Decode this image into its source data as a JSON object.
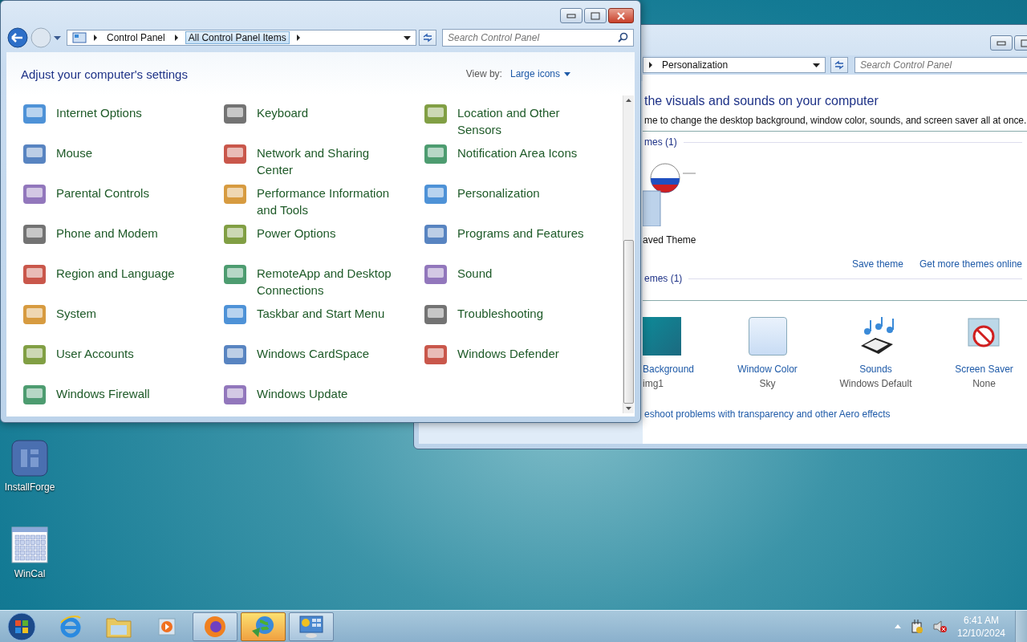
{
  "desktop_icons": [
    {
      "kind": "installer",
      "label": "InstallForge"
    },
    {
      "kind": "calendar",
      "label": "WinCal"
    }
  ],
  "background_window": {
    "breadcrumb": "Personalization",
    "search": {
      "placeholder": "Search Control Panel"
    },
    "heading": "the visuals and sounds on your computer",
    "description": "me to change the desktop background, window color, sounds, and screen saver all at once.",
    "my_themes_header": "mes (1)",
    "theme_name": "aved Theme",
    "links": [
      "Save theme",
      "Get more themes online"
    ],
    "installed_themes_header": "emes (1)",
    "settings": [
      {
        "kind": "background",
        "title": "Background",
        "value": "img1"
      },
      {
        "kind": "color",
        "title": "Window Color",
        "value": "Sky"
      },
      {
        "kind": "sounds",
        "title": "Sounds",
        "value": "Windows Default"
      },
      {
        "kind": "screensaver",
        "title": "Screen Saver",
        "value": "None"
      }
    ],
    "footer_link": "eshoot problems with transparency and other Aero effects"
  },
  "front_window": {
    "crumbs": [
      {
        "label": "Control Panel",
        "hovered": false
      },
      {
        "label": "All Control Panel Items",
        "hovered": true
      }
    ],
    "search": {
      "placeholder": "Search Control Panel"
    },
    "heading": "Adjust your computer's settings",
    "view_by": {
      "label": "View by:",
      "value": "Large icons"
    },
    "items": [
      "Internet Options",
      "Keyboard",
      "Location and Other Sensors",
      "Mouse",
      "Network and Sharing Center",
      "Notification Area Icons",
      "Parental Controls",
      "Performance Information and Tools",
      "Personalization",
      "Phone and Modem",
      "Power Options",
      "Programs and Features",
      "Region and Language",
      "RemoteApp and Desktop Connections",
      "Sound",
      "System",
      "Taskbar and Start Menu",
      "Troubleshooting",
      "User Accounts",
      "Windows CardSpace",
      "Windows Defender",
      "Windows Firewall",
      "Windows Update"
    ]
  },
  "taskbar": {
    "buttons": [
      {
        "kind": "browser",
        "running": false,
        "selected": false
      },
      {
        "kind": "folder",
        "running": false,
        "selected": false
      },
      {
        "kind": "media",
        "running": false,
        "selected": false
      },
      {
        "kind": "firefox",
        "running": true,
        "selected": false
      },
      {
        "kind": "globe",
        "running": true,
        "selected": true
      },
      {
        "kind": "control-panel",
        "running": true,
        "selected": false
      }
    ],
    "time": "6:41 AM",
    "date": "12/10/2024"
  }
}
